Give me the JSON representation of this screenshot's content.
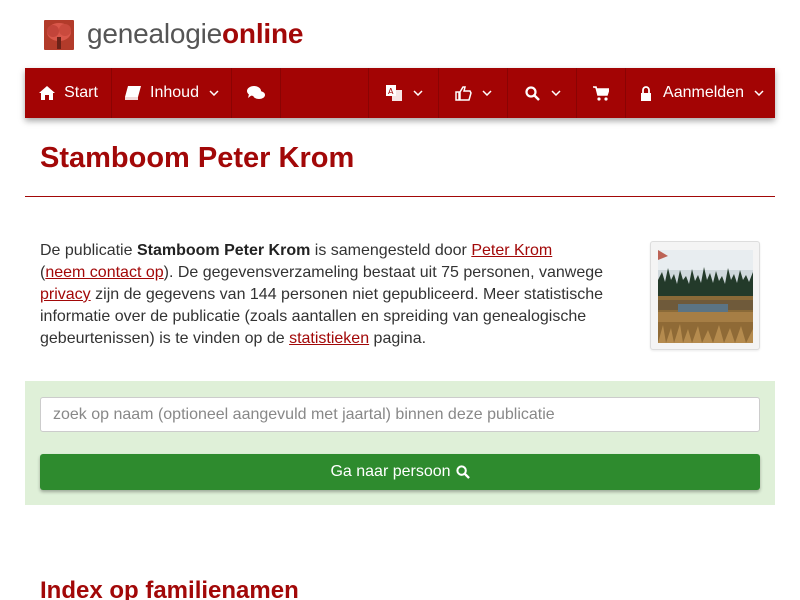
{
  "header": {
    "logo_icon": "tree-icon",
    "logo_part1": "genealogie",
    "logo_part2": "online"
  },
  "colors": {
    "brand_red": "#a30404",
    "search_bg": "#dff0d8",
    "button_green": "#2e8b2e"
  },
  "nav": {
    "start": {
      "label": "Start",
      "icon": "home-icon"
    },
    "inhoud": {
      "label": "Inhoud",
      "icon": "book-icon"
    },
    "chat": {
      "icon": "comments-icon"
    },
    "language": {
      "icon": "translate-icon"
    },
    "share": {
      "icon": "thumbs-up-icon"
    },
    "search": {
      "icon": "search-icon"
    },
    "cart": {
      "icon": "shopping-cart-icon"
    },
    "login": {
      "label": "Aanmelden",
      "icon": "lock-icon"
    }
  },
  "page": {
    "title": "Stamboom Peter Krom"
  },
  "intro": {
    "t1": "De publicatie ",
    "pub_name": "Stamboom Peter Krom",
    "t2": " is samengesteld door ",
    "author_link": "Peter Krom",
    "t3": "(",
    "contact_link": "neem contact op",
    "t4": "). De gegevensverzameling bestaat uit 75 personen, vanwege ",
    "privacy_link": "privacy",
    "t5": " zijn de gegevens van 144 personen niet gepubliceerd. Meer statistische informatie over de publicatie (zoals aantallen en spreiding van genealogische gebeurtenissen) is te vinden op de ",
    "stats_link": "statistieken",
    "t6": " pagina."
  },
  "search": {
    "placeholder": "zoek op naam (optioneel aangevuld met jaartal) binnen deze publicatie",
    "button_label": "Ga naar persoon",
    "button_icon": "search-icon"
  },
  "sections": {
    "index_title": "Index op familienamen"
  }
}
